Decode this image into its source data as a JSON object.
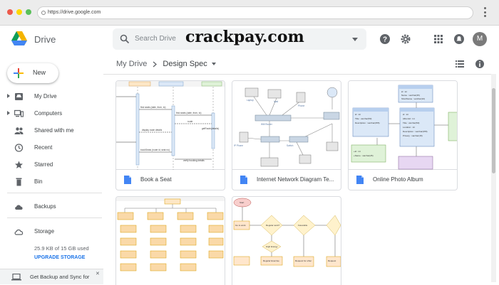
{
  "browser": {
    "url": "https://drive.google.com",
    "dot_colors": [
      "#ed594a",
      "#fdd800",
      "#5ac05a"
    ]
  },
  "app": {
    "name": "Drive",
    "search_placeholder": "Search Drive",
    "avatar_initial": "M",
    "watermark": "crackpay.com"
  },
  "sidebar": {
    "new_label": "New",
    "items": [
      {
        "label": "My Drive",
        "icon": "my-drive-icon"
      },
      {
        "label": "Computers",
        "icon": "computers-icon"
      },
      {
        "label": "Shared with me",
        "icon": "shared-icon"
      },
      {
        "label": "Recent",
        "icon": "clock-icon"
      },
      {
        "label": "Starred",
        "icon": "star-icon"
      },
      {
        "label": "Bin",
        "icon": "trash-icon"
      },
      {
        "label": "Backups",
        "icon": "cloud-icon"
      },
      {
        "label": "Storage",
        "icon": "cloud-outline-icon"
      }
    ],
    "storage_used": "25.9 KB of 15 GB used",
    "upgrade_label": "UPGRADE STORAGE",
    "banner_label": "Get Backup and Sync for"
  },
  "main": {
    "breadcrumb_root": "My Drive",
    "breadcrumb_current": "Design Spec",
    "files": [
      {
        "title": "Book a Seat",
        "type": "sequence-diagram"
      },
      {
        "title": "Internet Network Diagram Te...",
        "type": "network-diagram"
      },
      {
        "title": "Online Photo Album",
        "type": "class-diagram"
      },
      {
        "title": "",
        "type": "org-chart"
      },
      {
        "title": "",
        "type": "flowchart"
      }
    ]
  },
  "colors": {
    "accent": "#1a73e8",
    "drive_green": "#0f9d58",
    "drive_yellow": "#f4b400",
    "drive_blue": "#4285f4",
    "drive_red": "#db4437"
  }
}
